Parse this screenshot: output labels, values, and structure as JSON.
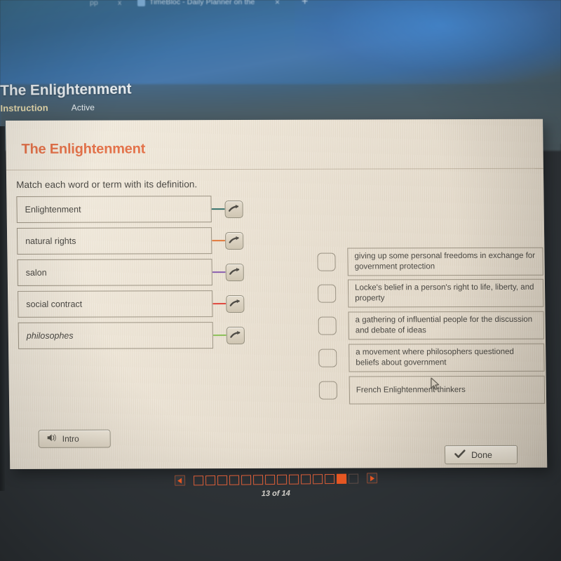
{
  "browser": {
    "tab_ghost_1": "pp",
    "tab_ghost_2": "x",
    "tab_title": "TimeBloc - Daily Planner on the",
    "close_label": "×",
    "new_tab_label": "+"
  },
  "page": {
    "title": "The Enlightenment",
    "section_label": "Instruction",
    "status_label": "Active"
  },
  "activity": {
    "title": "The Enlightenment",
    "instruction": "Match each word or term with its definition.",
    "terms": [
      {
        "label": "Enlightenment",
        "connector_color": "#35716b",
        "italic": false
      },
      {
        "label": "natural rights",
        "connector_color": "#e2793c",
        "italic": false
      },
      {
        "label": "salon",
        "connector_color": "#8a5fb0",
        "italic": false
      },
      {
        "label": "social contract",
        "connector_color": "#e0483f",
        "italic": false
      },
      {
        "label": "philosophes",
        "connector_color": "#8cc05a",
        "italic": true
      }
    ],
    "definitions": [
      "giving up some personal freedoms in exchange for government protection",
      "Locke's belief in a person's right to life, liberty, and property",
      "a gathering of influential people for the discussion and debate of ideas",
      "a movement where philosophers questioned beliefs about government",
      "French Enlightenment thinkers"
    ],
    "intro_button": "Intro",
    "done_button": "Done"
  },
  "pagination": {
    "prev_label": "◀",
    "next_label": "▶",
    "total": 14,
    "current": 13,
    "label": "13 of 14"
  },
  "colors": {
    "accent_orange": "#e3724a",
    "pager_orange": "#ef5a23",
    "panel_bg": "#ece3d4",
    "instruction_yellow": "#e8dcae"
  }
}
